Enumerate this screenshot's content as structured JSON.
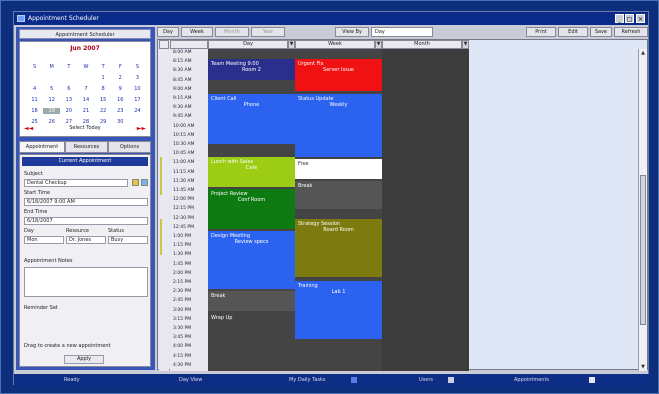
{
  "window": {
    "title": "Appointment Scheduler"
  },
  "sidebar": {
    "header": "Appointment Scheduler",
    "calendar": {
      "month": "Jun 2007",
      "days": [
        "S",
        "M",
        "T",
        "W",
        "T",
        "F",
        "S",
        "",
        "",
        "",
        "",
        "1",
        "2",
        "3",
        "4",
        "5",
        "6",
        "7",
        "8",
        "9",
        "10",
        "11",
        "12",
        "13",
        "14",
        "15",
        "16",
        "17",
        "18",
        "19",
        "20",
        "21",
        "22",
        "23",
        "24",
        "25",
        "26",
        "27",
        "28",
        "29",
        "30",
        "",
        ""
      ],
      "selected_index": 29,
      "footer": "Select Today"
    },
    "tabs": [
      "Appointment",
      "Resources",
      "Options"
    ],
    "form": {
      "title": "Current Appointment",
      "subject_label": "Subject",
      "subject_value": "Dental Checkup",
      "start_label": "Start Time",
      "start_value": "6/18/2007 9:00 AM",
      "end_label": "End Time",
      "end_value": "6/18/2007",
      "col_labels": [
        "Day",
        "Resource",
        "Status"
      ],
      "col_values": [
        "Mon",
        "Dr. Jones",
        "Busy"
      ],
      "notes_label": "Appointment Notes",
      "reminder_label": "Reminder Set",
      "footer_label": "Drag to create a new appointment",
      "apply_button": "Apply"
    }
  },
  "toolbar": {
    "buttons": [
      "Day",
      "Week",
      "Month",
      "Year"
    ],
    "disabled": [
      false,
      false,
      true,
      true
    ],
    "view_label": "View By",
    "view_value": "Day",
    "right_buttons": [
      "Print",
      "Edit",
      "Save",
      "Refresh"
    ]
  },
  "grid": {
    "columns": [
      "Day",
      "Week",
      "Month"
    ],
    "times": [
      "8:00 AM",
      "8:15 AM",
      "8:30 AM",
      "8:45 AM",
      "9:00 AM",
      "9:15 AM",
      "9:30 AM",
      "9:45 AM",
      "10:00 AM",
      "10:15 AM",
      "10:30 AM",
      "10:45 AM",
      "11:00 AM",
      "11:15 AM",
      "11:30 AM",
      "11:45 AM",
      "12:00 PM",
      "12:15 PM",
      "12:30 PM",
      "12:45 PM",
      "1:00 PM",
      "1:15 PM",
      "1:30 PM",
      "1:45 PM",
      "2:00 PM",
      "2:15 PM",
      "2:30 PM",
      "2:45 PM",
      "3:00 PM",
      "3:15 PM",
      "3:30 PM",
      "3:45 PM",
      "4:00 PM",
      "4:15 PM",
      "4:30 PM"
    ],
    "events_col1": [
      {
        "text": "Team Meeting 9:00",
        "sub": "Room 2",
        "color": "#2a2f8c"
      },
      {
        "text": "Client Call",
        "sub": "Phone",
        "color": "#2b63f0"
      },
      {
        "text": "Lunch with Sales",
        "sub": "Cafe",
        "color": "#9ccc14"
      },
      {
        "text": "Project Review",
        "sub": "Conf Room",
        "color": "#0d7a12"
      },
      {
        "text": "Design Meeting",
        "sub": "Review specs",
        "color": "#2b63f0"
      },
      {
        "text": "Break",
        "sub": "",
        "color": "#555555"
      },
      {
        "text": "Wrap Up",
        "sub": "",
        "color": "#444444"
      }
    ],
    "events_col2": [
      {
        "text": "Urgent Fix",
        "sub": "Server Issue",
        "color": "#f01212"
      },
      {
        "text": "Status Update",
        "sub": "Weekly",
        "color": "#2b63f0"
      },
      {
        "text": "Free",
        "sub": "",
        "color": "#ffffff"
      },
      {
        "text": "Break",
        "sub": "",
        "color": "#555555"
      },
      {
        "text": "Strategy Session",
        "sub": "Board Room",
        "color": "#7d7a10"
      },
      {
        "text": "Training",
        "sub": "Lab 1",
        "color": "#2b63f0"
      }
    ]
  },
  "status": {
    "items": [
      "Ready",
      "Day View",
      "My Daily Tasks",
      "Users",
      "Appointments"
    ]
  },
  "colors": {
    "accent": "#0e2d85",
    "sidebar": "#3a55b8"
  }
}
